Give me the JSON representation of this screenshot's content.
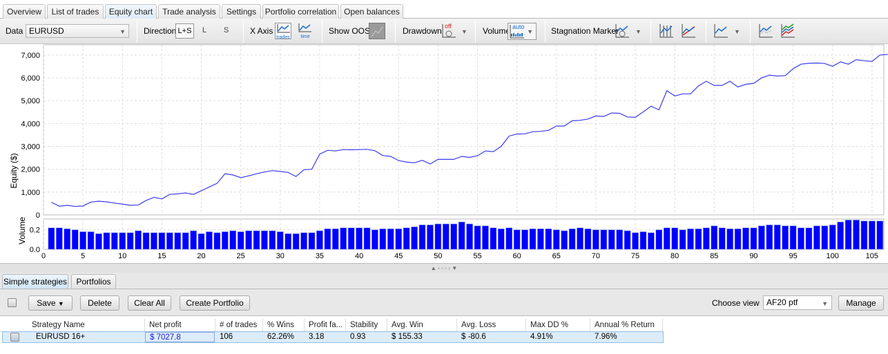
{
  "tabs": [
    {
      "label": "Overview"
    },
    {
      "label": "List of trades"
    },
    {
      "label": "Equity chart",
      "active": true
    },
    {
      "label": "Trade analysis"
    },
    {
      "label": "Settings"
    },
    {
      "label": "Portfolio correlation"
    },
    {
      "label": "Open balances"
    }
  ],
  "toolbar": {
    "data_label": "Data",
    "data_value": "EURUSD",
    "direction_label": "Direction",
    "direction_options": [
      "L+S",
      "L",
      "S"
    ],
    "direction_selected": "L+S",
    "xaxis_label": "X Axis",
    "xaxis_trades": "trades",
    "xaxis_time": "time",
    "show_oos_label": "Show OOS",
    "drawdown_label": "Drawdown",
    "drawdown_state": "off",
    "volume_label": "Volume",
    "volume_state": "auto",
    "stagnation_label": "Stagnation Marker"
  },
  "chart_data": [
    {
      "type": "line",
      "ylabel": "Equity ($)",
      "ylim": [
        0,
        7450
      ],
      "xlim": [
        0,
        106.5
      ],
      "grid": true,
      "yticks": [
        "0",
        "1,000",
        "2,000",
        "3,000",
        "4,000",
        "5,000",
        "6,000",
        "7,000"
      ],
      "series": [
        {
          "color": "#3b3bf0",
          "x_start": 1,
          "values": [
            550,
            380,
            420,
            370,
            390,
            560,
            600,
            570,
            520,
            470,
            420,
            430,
            630,
            770,
            700,
            900,
            920,
            960,
            900,
            1060,
            1220,
            1380,
            1800,
            1750,
            1630,
            1710,
            1800,
            1880,
            1940,
            1900,
            1860,
            1680,
            1980,
            2000,
            2660,
            2830,
            2800,
            2860,
            2850,
            2860,
            2870,
            2810,
            2600,
            2560,
            2380,
            2310,
            2280,
            2390,
            2230,
            2430,
            2430,
            2430,
            2560,
            2520,
            2590,
            2800,
            2770,
            3000,
            3450,
            3540,
            3550,
            3640,
            3660,
            3700,
            3890,
            3890,
            4120,
            4140,
            4200,
            4330,
            4310,
            4460,
            4450,
            4290,
            4270,
            4510,
            4760,
            4600,
            5440,
            5210,
            5300,
            5300,
            5650,
            5850,
            5670,
            5670,
            5850,
            5600,
            5720,
            5760,
            6000,
            6120,
            6080,
            6100,
            6400,
            6600,
            6640,
            6650,
            6630,
            6510,
            6700,
            6600,
            6800,
            6750,
            6720,
            7000,
            7028
          ]
        }
      ]
    },
    {
      "type": "bar",
      "ylabel": "Volume",
      "ylim": [
        0,
        0.31
      ],
      "xlim": [
        0,
        106.5
      ],
      "grid": true,
      "yticks": [
        "0.0",
        "0.2"
      ],
      "xticks": [
        "0",
        "5",
        "10",
        "15",
        "20",
        "25",
        "30",
        "35",
        "40",
        "45",
        "50",
        "55",
        "60",
        "65",
        "70",
        "75",
        "80",
        "85",
        "90",
        "95",
        "100",
        "105"
      ],
      "color": "#0000ff",
      "x_start": 1,
      "values": [
        0.22,
        0.22,
        0.21,
        0.2,
        0.18,
        0.18,
        0.16,
        0.17,
        0.17,
        0.17,
        0.17,
        0.19,
        0.17,
        0.17,
        0.17,
        0.17,
        0.17,
        0.17,
        0.19,
        0.16,
        0.18,
        0.17,
        0.18,
        0.19,
        0.18,
        0.19,
        0.19,
        0.19,
        0.19,
        0.18,
        0.16,
        0.16,
        0.17,
        0.17,
        0.19,
        0.21,
        0.21,
        0.22,
        0.22,
        0.22,
        0.22,
        0.2,
        0.21,
        0.21,
        0.21,
        0.22,
        0.23,
        0.25,
        0.25,
        0.26,
        0.26,
        0.26,
        0.28,
        0.26,
        0.24,
        0.24,
        0.22,
        0.21,
        0.22,
        0.2,
        0.2,
        0.21,
        0.21,
        0.21,
        0.2,
        0.19,
        0.21,
        0.22,
        0.21,
        0.2,
        0.2,
        0.2,
        0.2,
        0.19,
        0.17,
        0.18,
        0.17,
        0.2,
        0.22,
        0.22,
        0.2,
        0.21,
        0.21,
        0.22,
        0.24,
        0.22,
        0.21,
        0.21,
        0.22,
        0.22,
        0.24,
        0.25,
        0.25,
        0.24,
        0.24,
        0.22,
        0.22,
        0.24,
        0.24,
        0.25,
        0.28,
        0.3,
        0.3,
        0.29,
        0.29,
        0.29
      ]
    }
  ],
  "lower": {
    "tabs": [
      {
        "label": "Simple strategies",
        "active": true
      },
      {
        "label": "Portfolios"
      }
    ],
    "save": "Save",
    "delete": "Delete",
    "clear_all": "Clear All",
    "create_portfolio": "Create Portfolio",
    "choose_view_label": "Choose view",
    "choose_view_value": "AF20 ptf",
    "manage": "Manage"
  },
  "table": {
    "headers": [
      "Strategy Name",
      "Net profit",
      "# of trades",
      "% Wins",
      "Profit fa...",
      "Stability",
      "Avg. Win",
      "Avg. Loss",
      "Max DD %",
      "Annual % Return"
    ],
    "rows": [
      [
        "EURUSD 16+",
        "$ 7027.8",
        "106",
        "62.26%",
        "3.18",
        "0.93",
        "$ 155.33",
        "$ -80.6",
        "4.91%",
        "7.96%"
      ]
    ]
  }
}
